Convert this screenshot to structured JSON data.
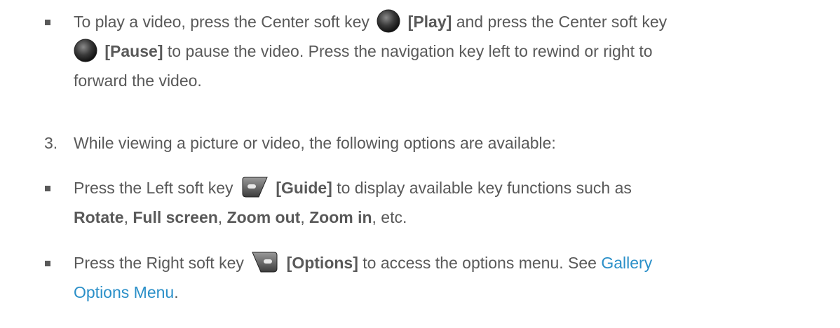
{
  "bullet1": {
    "part1": "To play a video, press the Center soft key",
    "play_label": "[Play]",
    "part2": "and press the Center soft key",
    "pause_label": "[Pause]",
    "part3": "to pause the video. Press the navigation key left to rewind or right to",
    "part4": "forward the video."
  },
  "step3": {
    "number": "3.",
    "text": "While viewing a picture or video, the following options are available:"
  },
  "bullet2": {
    "part1": "Press the Left soft key",
    "guide_label": "[Guide]",
    "part2": "to display available key functions such as",
    "rotate": "Rotate",
    "sep1": ",",
    "full_screen": "Full screen",
    "sep2": ",",
    "zoom_out": "Zoom out",
    "sep3": ",",
    "zoom_in": "Zoom in",
    "tail": ", etc."
  },
  "bullet3": {
    "part1": "Press the Right soft key",
    "options_label": "[Options]",
    "part2": "to access the options menu. See",
    "link_line1": "Gallery",
    "link_line2": "Options Menu",
    "period": "."
  },
  "icons": {
    "center_key": "center-soft-key-icon",
    "left_key": "left-soft-key-icon",
    "right_key": "right-soft-key-icon"
  },
  "colors": {
    "text": "#595959",
    "link": "#2a8fc8"
  }
}
